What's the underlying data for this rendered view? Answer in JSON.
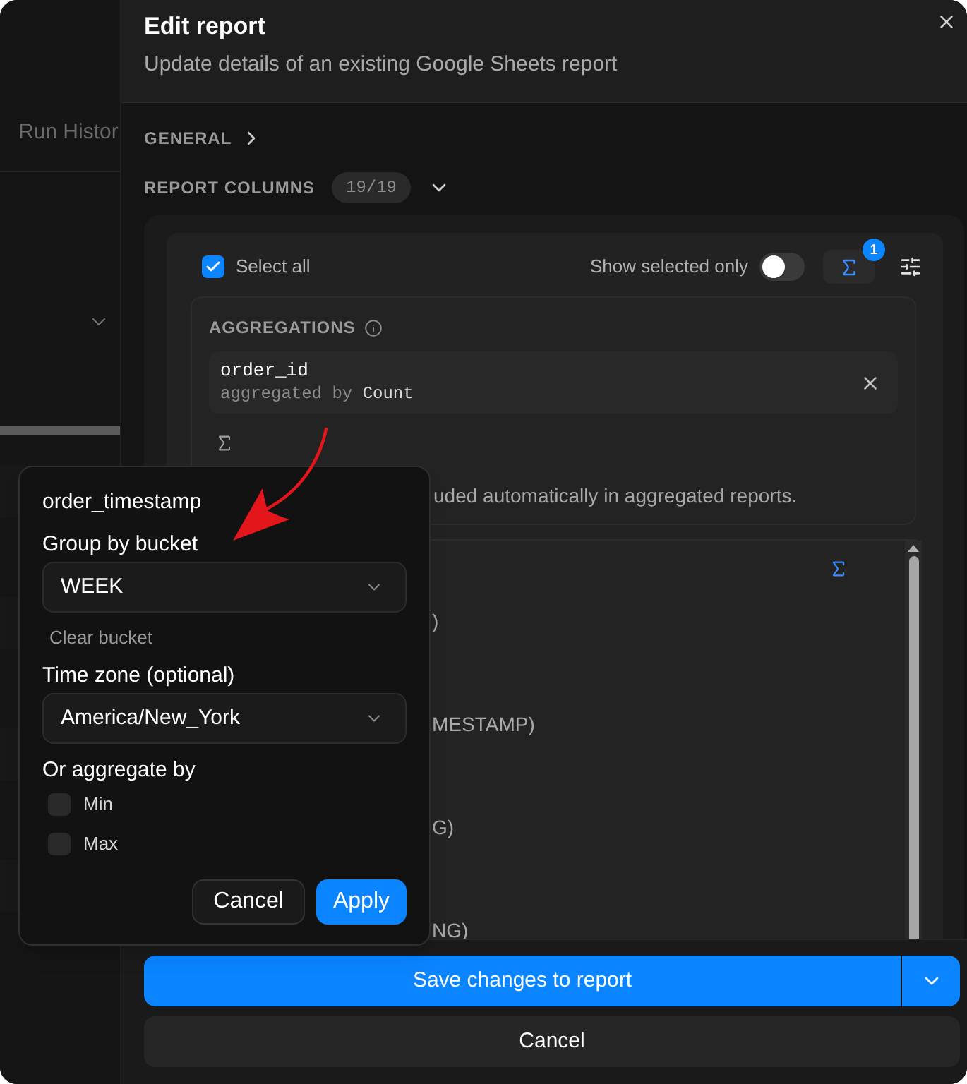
{
  "background": {
    "tab_label": "Run Histor"
  },
  "drawer": {
    "title": "Edit report",
    "subtitle": "Update details of an existing Google Sheets report"
  },
  "sections": [
    {
      "label": "GENERAL",
      "expanded": false
    },
    {
      "label": "REPORT COLUMNS",
      "count": "19/19",
      "expanded": true
    }
  ],
  "columns_panel": {
    "select_all": {
      "label": "Select all",
      "checked": true
    },
    "show_selected_only": {
      "label": "Show selected only",
      "on": false
    },
    "aggregate_count": "1",
    "aggregations": {
      "title": "AGGREGATIONS",
      "items": [
        {
          "column": "order_id",
          "by_label": "aggregated by",
          "function": "Count"
        }
      ],
      "note": "uded automatically in aggregated reports."
    },
    "list_fragments": [
      ")",
      "MESTAMP)",
      "G)",
      "NG)"
    ]
  },
  "popover": {
    "column": "order_timestamp",
    "fields": [
      {
        "label": "Group by bucket",
        "value": "WEEK",
        "action": "Clear bucket"
      },
      {
        "label": "Time zone (optional)",
        "value": "America/New_York"
      }
    ],
    "aggregate_label": "Or aggregate by",
    "options": [
      {
        "label": "Min",
        "checked": false
      },
      {
        "label": "Max",
        "checked": false
      }
    ],
    "buttons": [
      {
        "label": "Cancel",
        "kind": "secondary"
      },
      {
        "label": "Apply",
        "kind": "primary"
      }
    ]
  },
  "footer": {
    "save": "Save changes to report",
    "cancel": "Cancel"
  }
}
